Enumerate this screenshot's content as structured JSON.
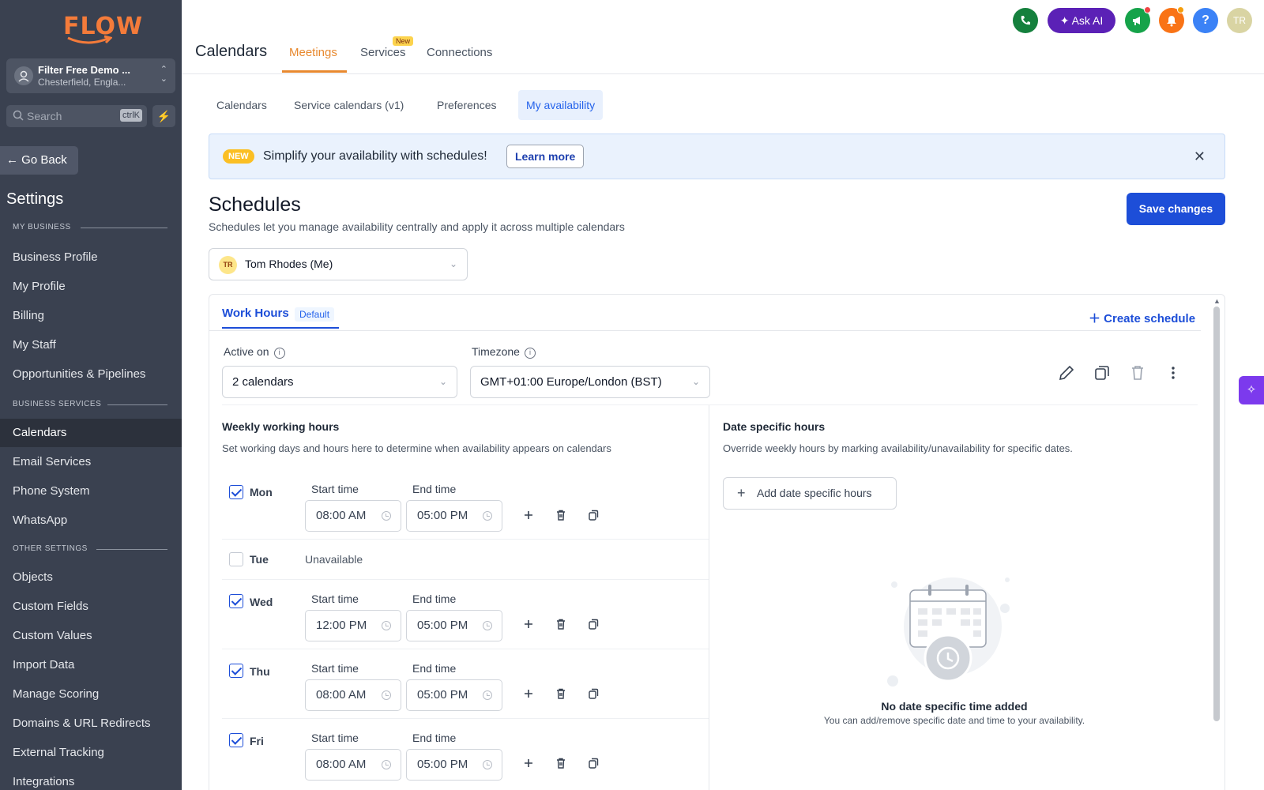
{
  "sidebar": {
    "logo": "FLOW",
    "account_name": "Filter Free Demo ...",
    "account_location": "Chesterfield, Engla...",
    "search_placeholder": "Search",
    "search_shortcut": "ctrlK",
    "go_back": "Go Back",
    "settings_title": "Settings",
    "sections": {
      "my_business": "MY BUSINESS",
      "business_services": "BUSINESS SERVICES",
      "other_settings": "OTHER SETTINGS"
    },
    "items": [
      {
        "label": "Business Profile"
      },
      {
        "label": "My Profile"
      },
      {
        "label": "Billing"
      },
      {
        "label": "My Staff"
      },
      {
        "label": "Opportunities & Pipelines"
      },
      {
        "label": "Calendars"
      },
      {
        "label": "Email Services"
      },
      {
        "label": "Phone System"
      },
      {
        "label": "WhatsApp"
      },
      {
        "label": "Objects"
      },
      {
        "label": "Custom Fields"
      },
      {
        "label": "Custom Values"
      },
      {
        "label": "Import Data"
      },
      {
        "label": "Manage Scoring"
      },
      {
        "label": "Domains & URL Redirects"
      },
      {
        "label": "External Tracking"
      },
      {
        "label": "Integrations"
      }
    ],
    "active_item": "Calendars"
  },
  "header": {
    "title": "Calendars",
    "tabs": [
      {
        "label": "Meetings"
      },
      {
        "label": "Services"
      },
      {
        "label": "Connections"
      }
    ],
    "new_badge": "New",
    "active_tab": "Meetings",
    "ask_ai": "Ask AI",
    "help": "?",
    "user_initials": "TR"
  },
  "subtabs": [
    {
      "label": "Calendars"
    },
    {
      "label": "Service calendars (v1)"
    },
    {
      "label": "Preferences"
    },
    {
      "label": "My availability"
    }
  ],
  "active_subtab": "My availability",
  "banner": {
    "tag": "NEW",
    "message": "Simplify your availability with schedules!",
    "learn_more": "Learn more"
  },
  "schedules": {
    "title": "Schedules",
    "subtitle": "Schedules let you manage availability centrally and apply it across multiple calendars",
    "save_button": "Save changes",
    "user_initials": "TR",
    "user_select": "Tom Rhodes (Me)"
  },
  "card": {
    "tab_label": "Work Hours",
    "default_badge": "Default",
    "create_schedule": "Create schedule",
    "active_on_label": "Active on",
    "active_on_value": "2 calendars",
    "timezone_label": "Timezone",
    "timezone_value": "GMT+01:00 Europe/London (BST)",
    "weekly_title": "Weekly working hours",
    "weekly_desc": "Set working days and hours here to determine when availability appears on calendars",
    "start_label": "Start time",
    "end_label": "End time",
    "unavailable": "Unavailable",
    "days": [
      {
        "day": "Mon",
        "checked": true,
        "start": "08:00 AM",
        "end": "05:00 PM"
      },
      {
        "day": "Tue",
        "checked": false
      },
      {
        "day": "Wed",
        "checked": true,
        "start": "12:00 PM",
        "end": "05:00 PM"
      },
      {
        "day": "Thu",
        "checked": true,
        "start": "08:00 AM",
        "end": "05:00 PM"
      },
      {
        "day": "Fri",
        "checked": true,
        "start": "08:00 AM",
        "end": "05:00 PM"
      }
    ],
    "date_title": "Date specific hours",
    "date_desc": "Override weekly hours by marking availability/unavailability for specific dates.",
    "add_date_button": "Add date specific hours",
    "empty_title": "No date specific time added",
    "empty_sub": "You can add/remove specific date and time to your availability."
  },
  "colors": {
    "sidebar_bg": "#3a4150",
    "accent_orange": "#e8892f",
    "primary_blue": "#1d4ed8",
    "ai_purple": "#5b21b6"
  }
}
